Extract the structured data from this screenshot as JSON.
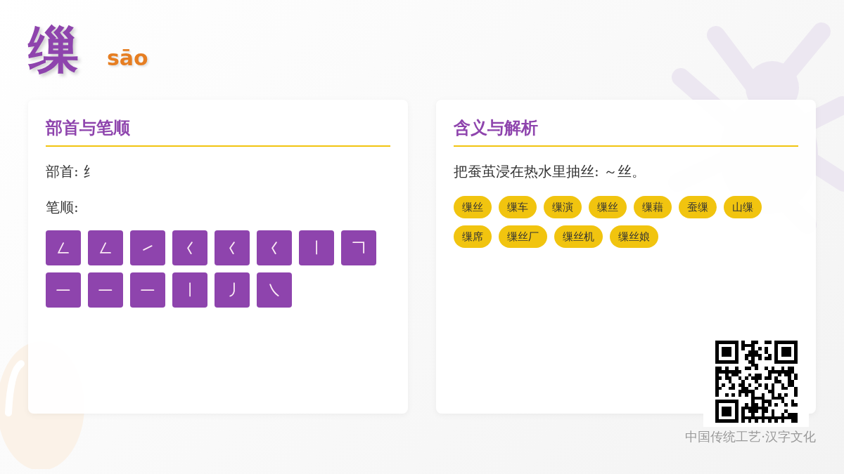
{
  "character": "缫",
  "pinyin": "sāo",
  "radical_card": {
    "title": "部首与笔顺",
    "radical": "部首: 纟",
    "strokes_label": "笔顺:",
    "strokes": [
      {
        "kind": "pz"
      },
      {
        "kind": "pz"
      },
      {
        "kind": "t"
      },
      {
        "kind": "pd"
      },
      {
        "kind": "pd"
      },
      {
        "kind": "pd"
      },
      {
        "kind": "s"
      },
      {
        "kind": "hz"
      },
      {
        "kind": "h"
      },
      {
        "kind": "h"
      },
      {
        "kind": "h"
      },
      {
        "kind": "s"
      },
      {
        "kind": "p"
      },
      {
        "kind": "n"
      }
    ]
  },
  "meaning_card": {
    "title": "含义与解析",
    "definition": "把蚕茧浸在热水里抽丝: ～丝。",
    "words": [
      "缫丝",
      "缫车",
      "缫演",
      "缫丝",
      "缫藉",
      "蚕缫",
      "山缫",
      "缫席",
      "缫丝厂",
      "缫丝机",
      "缫丝娘"
    ]
  },
  "footer": "中国传统工艺·汉字文化"
}
